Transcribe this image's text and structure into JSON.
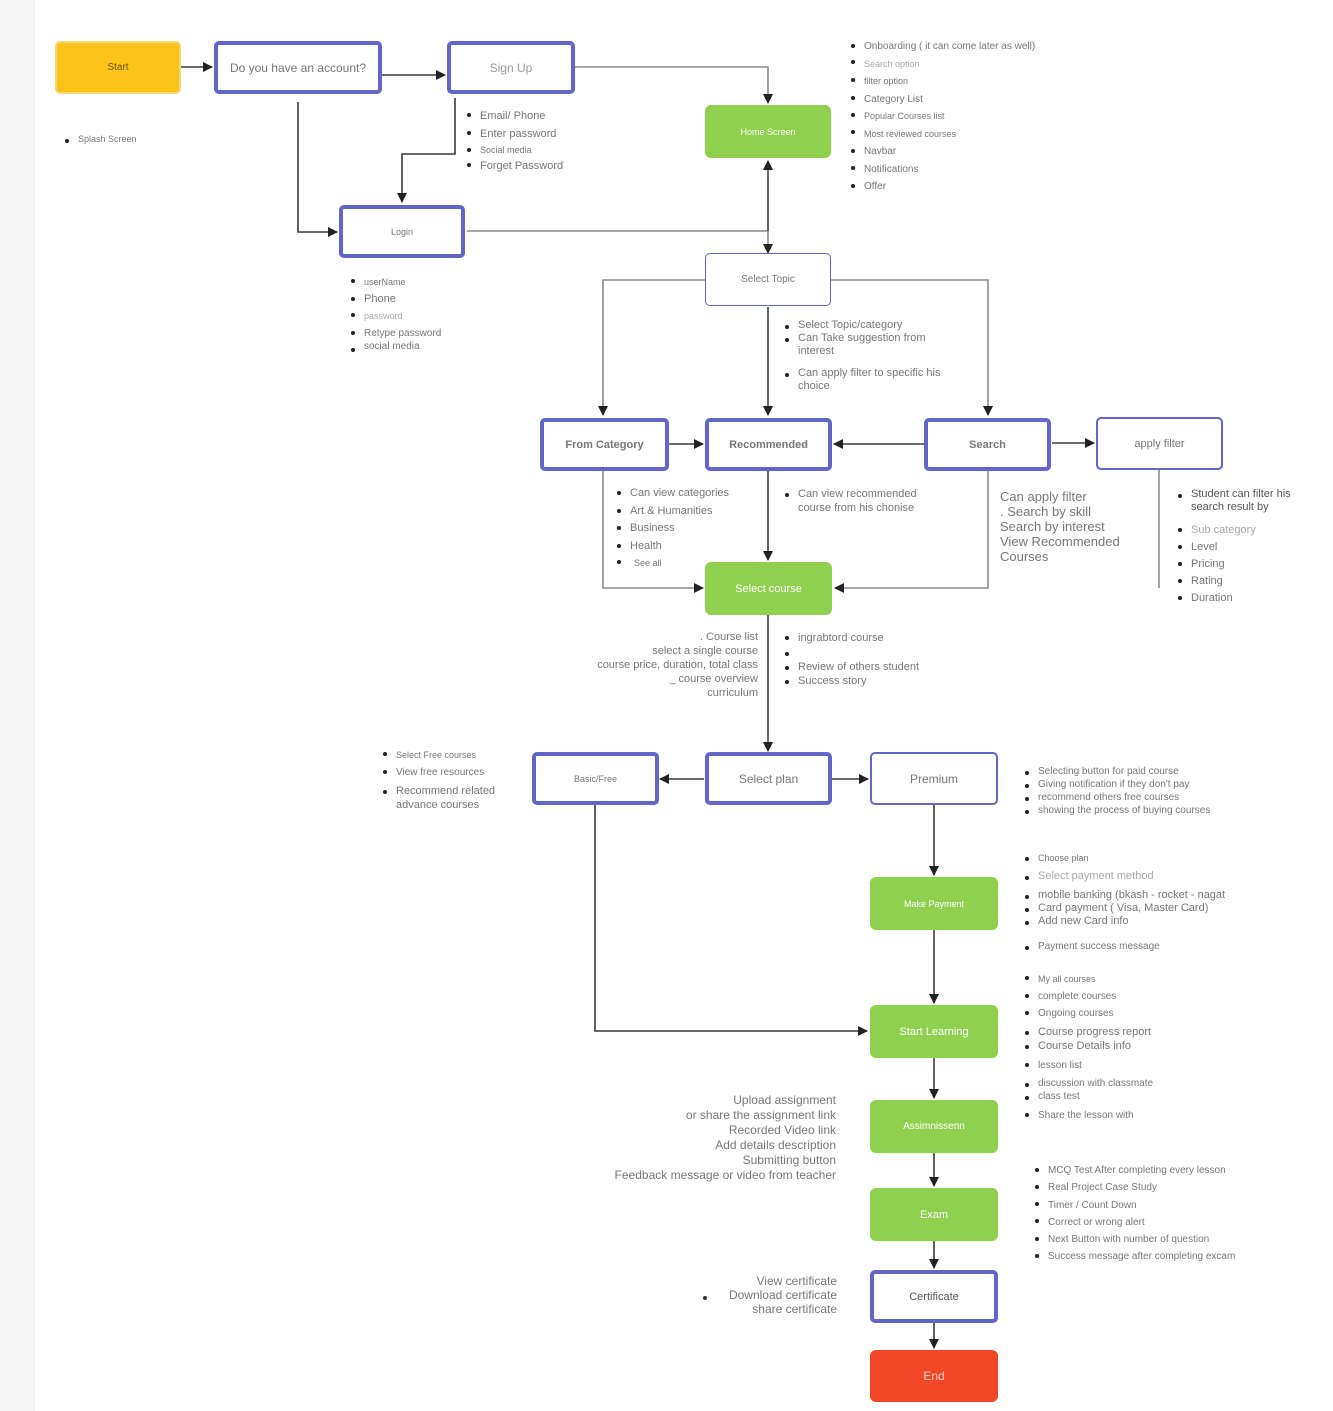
{
  "colors": {
    "outline": "#6366c9",
    "process": "#8fd14f",
    "start": "#fcc419",
    "end": "#f24726",
    "arrow": "#3a3a3a",
    "text": "#777777"
  },
  "nodes": {
    "start": "Start",
    "account_question": "Do you have an account?",
    "sign_up": "Sign Up",
    "login": "Login",
    "home_screen": "Home Screen",
    "select_topic": "Select Topic",
    "from_category": "From Category",
    "recommended": "Recommended",
    "search": "Search",
    "apply_filter": "apply filter",
    "select_course": "Select course",
    "basic_free": "Basic/Free",
    "select_plan": "Select plan",
    "premium": "Premium",
    "make_payment": "Make Payment",
    "start_learning": "Start Learning",
    "assignment": "Assimnissenn",
    "exam": "Exam",
    "certificate": "Certificate",
    "end": "End"
  },
  "notes": {
    "splash": [
      "Splash Screen"
    ],
    "sign_up": [
      "Email/ Phone",
      "Enter password",
      "Social media",
      "Forget Password"
    ],
    "home": [
      "Onboarding ( it can come later as well)",
      "Search option",
      "filter option",
      "Category List",
      "Popular Courses list",
      "Most reviewed courses",
      "Navbar",
      "Notifications",
      "Offer"
    ],
    "login": [
      "userName",
      "Phone",
      "password",
      "Retype password",
      "social media"
    ],
    "select_topic": [
      "Select Topic/category",
      "Can Take suggestion from interest",
      "Can apply filter to specific his choice"
    ],
    "category": [
      "Can view categories",
      "Art & Humanities",
      "Business",
      "Health",
      "See all"
    ],
    "recommended": [
      "Can view recommended course from his chonise"
    ],
    "search": [
      "Can apply filter",
      ". Search by skill",
      "Search by interest",
      "View Recommended",
      "Courses"
    ],
    "filter_title": "Student can filter his search result by",
    "filter": [
      "Sub category",
      "Level",
      "Pricing",
      "Rating",
      "Duration"
    ],
    "course_left": [
      ". Course list",
      "select a single course",
      "course price, duration, total class",
      "_ course overview",
      "curriculum"
    ],
    "course_right": [
      "ingrabtord course",
      "",
      "Review of others student",
      "Success story"
    ],
    "free": [
      "Select Free courses",
      "View free resources",
      "Recommend related advance courses"
    ],
    "premium": [
      "Selecting button for paid course",
      "Giving notification if they don't pay",
      "recommend others free courses",
      "showing the process of buying courses"
    ],
    "payment": [
      "Choose plan",
      "Select payment method",
      "mobile banking (bkash - rocket - nagat",
      "Card payment ( Visa, Master Card)",
      "Add new Card info",
      "Payment success message"
    ],
    "learning": [
      "My all courses",
      "complete courses",
      "Ongoing courses",
      "Course progress report",
      "Course Details info",
      "lesson list",
      "discussion with classmate",
      "class test",
      "Share the lesson with"
    ],
    "assignment": [
      "Upload assignment",
      "or share the assignment link",
      "Recorded Video link",
      "Add details description",
      "Submitting button",
      "Feedback message or video from teacher"
    ],
    "exam": [
      "MCQ Test After completing every lesson",
      "Real Project Case Study",
      "Timer / Count Down",
      "Correct or wrong alert",
      "Next Button with number of question",
      "Success message after completing excam"
    ],
    "certificate": [
      "View certificate",
      "Download certificate",
      "share certificate"
    ]
  }
}
